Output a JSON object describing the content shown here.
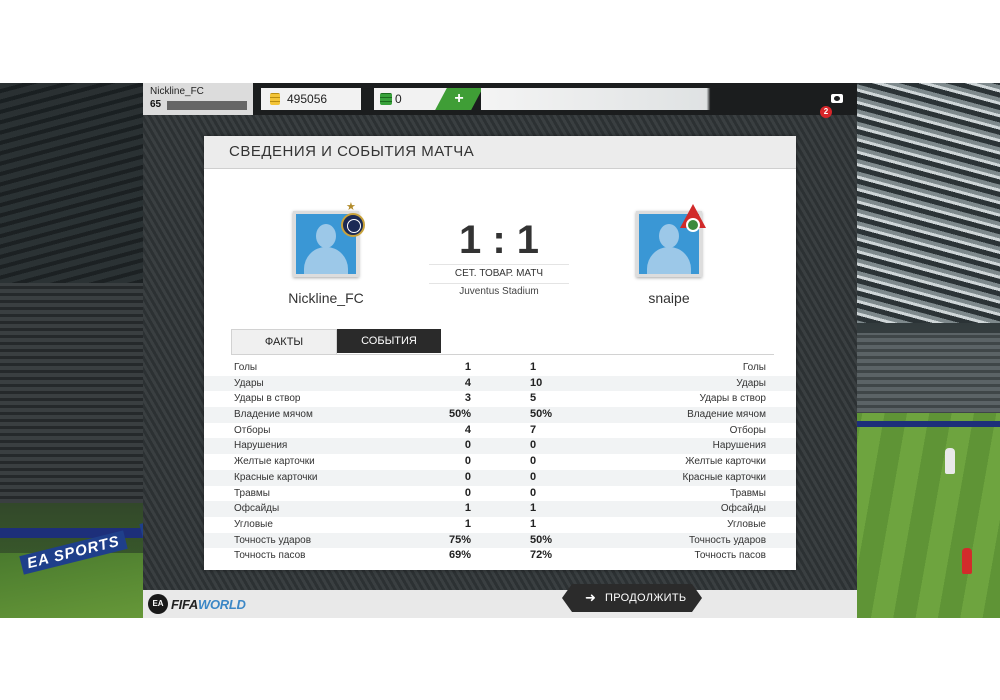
{
  "topbar": {
    "profile_name": "Nickline_FC",
    "profile_level": "65",
    "coins": "495056",
    "points": "0",
    "add_label": "+",
    "notifications": "2"
  },
  "card": {
    "title": "СВЕДЕНИЯ И СОБЫТИЯ МАТЧА",
    "home_team": "Nickline_FC",
    "away_team": "snaipe",
    "score": "1 : 1",
    "match_type": "СЕТ. ТОВАР. МАТЧ",
    "stadium": "Juventus Stadium"
  },
  "tabs": [
    {
      "label": "ФАКТЫ",
      "active": true
    },
    {
      "label": "СОБЫТИЯ",
      "active": false
    }
  ],
  "stats": [
    {
      "label": "Голы",
      "home": "1",
      "away": "1"
    },
    {
      "label": "Удары",
      "home": "4",
      "away": "10"
    },
    {
      "label": "Удары в створ",
      "home": "3",
      "away": "5"
    },
    {
      "label": "Владение мячом",
      "home": "50%",
      "away": "50%"
    },
    {
      "label": "Отборы",
      "home": "4",
      "away": "7"
    },
    {
      "label": "Нарушения",
      "home": "0",
      "away": "0"
    },
    {
      "label": "Желтые карточки",
      "home": "0",
      "away": "0"
    },
    {
      "label": "Красные карточки",
      "home": "0",
      "away": "0"
    },
    {
      "label": "Травмы",
      "home": "0",
      "away": "0"
    },
    {
      "label": "Офсайды",
      "home": "1",
      "away": "1"
    },
    {
      "label": "Угловые",
      "home": "1",
      "away": "1"
    },
    {
      "label": "Точность ударов",
      "home": "75%",
      "away": "50%"
    },
    {
      "label": "Точность пасов",
      "home": "69%",
      "away": "72%"
    }
  ],
  "bottombar": {
    "logo_ea": "EA",
    "logo_fifa": "FIFA",
    "logo_world": "WORLD",
    "continue_label": "ПРОДОЛЖИТЬ"
  },
  "background": {
    "adboard_text": "EA SPORTS"
  },
  "colors": {
    "accent_green": "#3f9e36",
    "avatar_blue": "#3a97d5",
    "notification_red": "#d7262a",
    "dark_button": "#2b2b2b"
  },
  "icons": [
    "coins-icon",
    "fifa-points-icon",
    "add-icon",
    "camera-icon",
    "avatar-placeholder-icon",
    "club-badge-inter-icon",
    "club-badge-lokomotiv-icon",
    "star-icon",
    "arrow-right-icon",
    "fifa-world-logo"
  ]
}
